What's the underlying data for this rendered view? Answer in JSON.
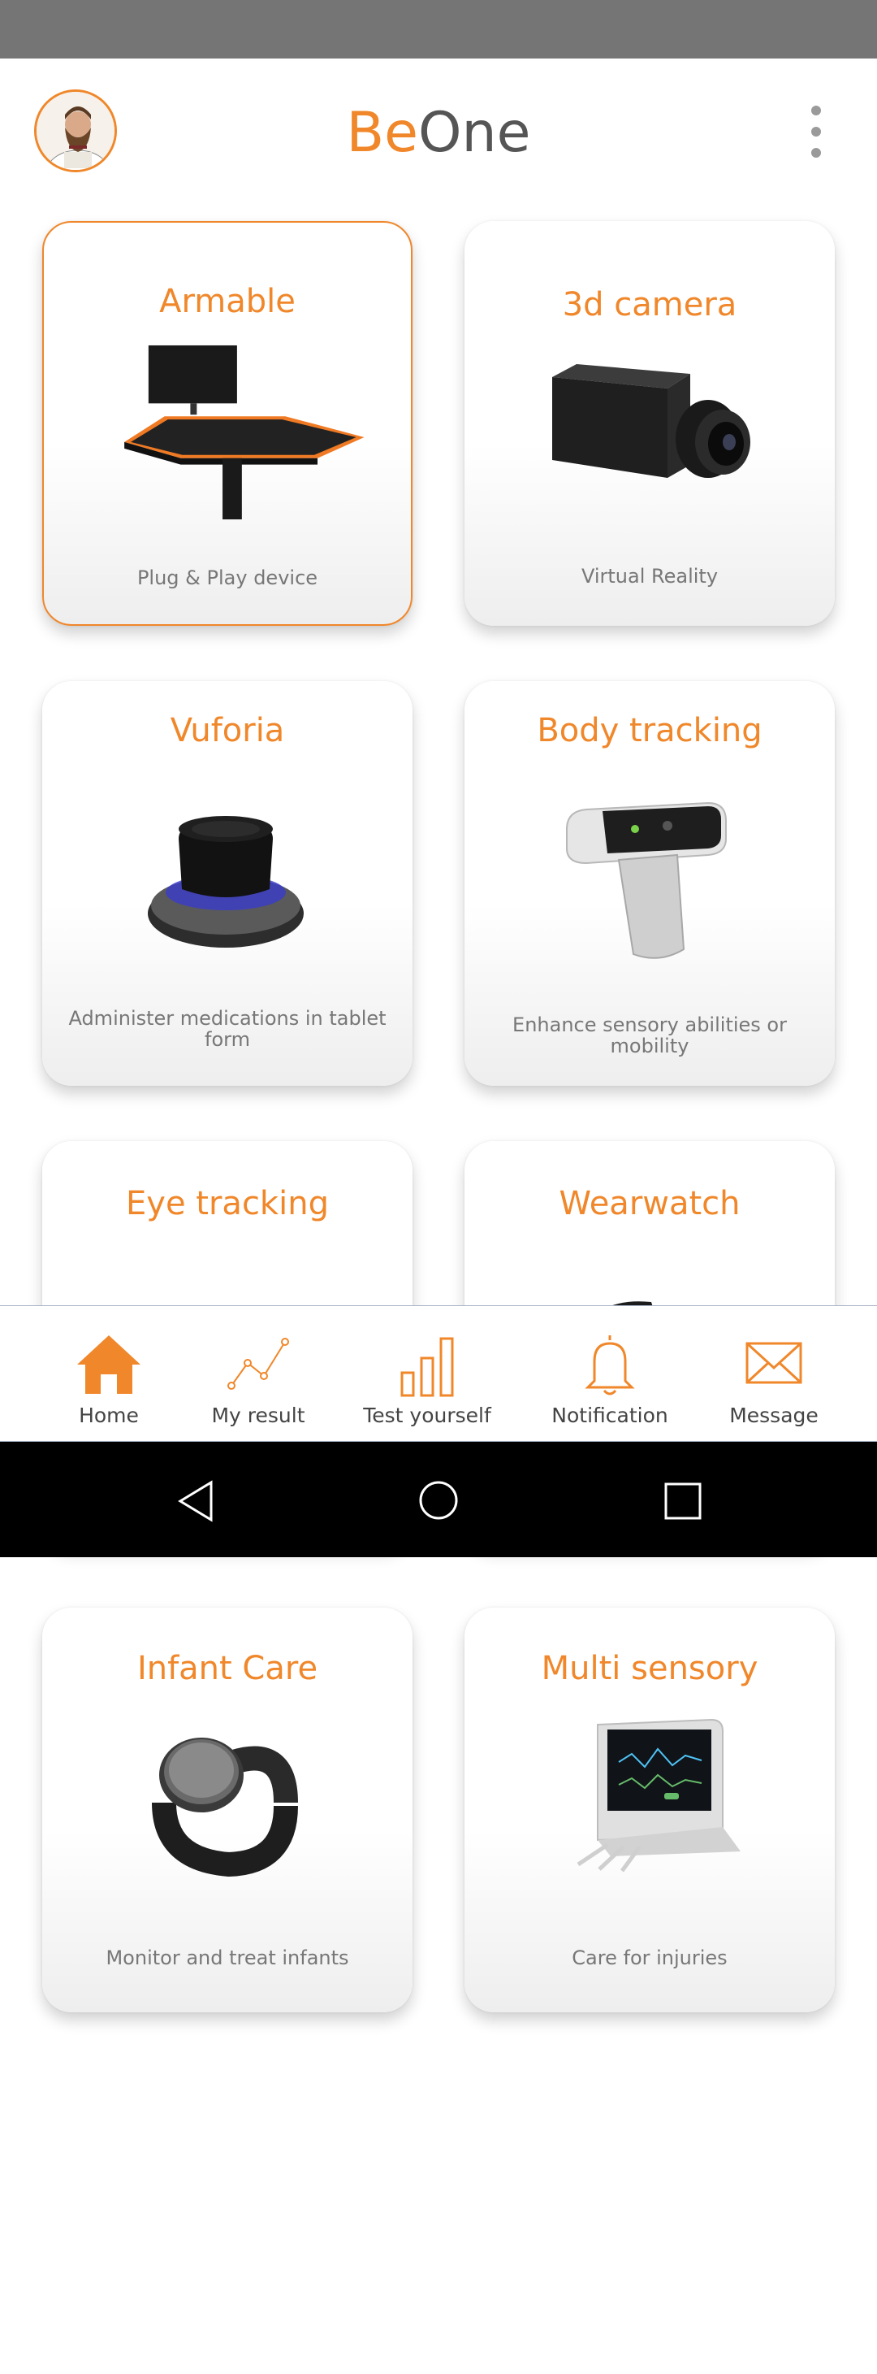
{
  "app": {
    "brand_part1": "Be",
    "brand_part2": "One",
    "accent_color": "#f0872a"
  },
  "header": {
    "avatar_icon": "user-avatar",
    "menu_icon": "more-vertical-icon"
  },
  "cards": [
    {
      "title": "Armable",
      "subtitle": "Plug & Play device",
      "icon": "armable-table",
      "selected": true
    },
    {
      "title": "3d camera",
      "subtitle": "Virtual Reality",
      "icon": "camera"
    },
    {
      "title": "Vuforia",
      "subtitle": "Administer medications in tablet form",
      "icon": "vuforia-controller"
    },
    {
      "title": "Body tracking",
      "subtitle": "Enhance sensory abilities or mobility",
      "icon": "body-tracker-clip"
    },
    {
      "title": "Eye tracking",
      "subtitle": "",
      "icon": "eye-tracker"
    },
    {
      "title": "Wearwatch",
      "subtitle": "",
      "icon": "wearwatch"
    },
    {
      "title": "Infant Care",
      "subtitle": "Monitor and treat infants",
      "icon": "infant-band"
    },
    {
      "title": "Multi sensory",
      "subtitle": "Care for injuries",
      "icon": "monitor-device"
    }
  ],
  "bottom_nav": [
    {
      "label": "Home",
      "icon": "home-icon",
      "active": true
    },
    {
      "label": "My result",
      "icon": "line-chart-icon"
    },
    {
      "label": "Test yourself",
      "icon": "bar-chart-icon"
    },
    {
      "label": "Notification",
      "icon": "bell-icon"
    },
    {
      "label": "Message",
      "icon": "envelope-icon"
    }
  ],
  "system_nav": [
    "back-icon",
    "home-circle-icon",
    "recents-icon"
  ]
}
